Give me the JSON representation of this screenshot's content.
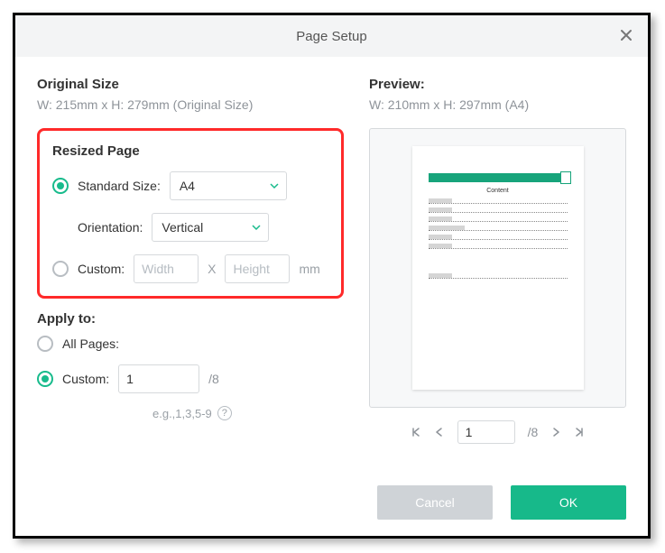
{
  "title": "Page Setup",
  "original": {
    "heading": "Original Size",
    "text": "W: 215mm x H: 279mm (Original Size)"
  },
  "resized": {
    "heading": "Resized Page",
    "standard_label": "Standard Size:",
    "size_value": "A4",
    "orientation_label": "Orientation:",
    "orientation_value": "Vertical",
    "custom_label": "Custom:",
    "width_placeholder": "Width",
    "height_placeholder": "Height",
    "x": "X",
    "unit": "mm",
    "selected": "standard"
  },
  "apply": {
    "heading": "Apply to:",
    "all_label": "All Pages:",
    "custom_label": "Custom:",
    "custom_value": "1",
    "total_suffix": "/8",
    "example": "e.g.,1,3,5-9",
    "selected": "custom"
  },
  "preview": {
    "heading": "Preview:",
    "text": "W: 210mm x H: 297mm (A4)",
    "page_value": "1",
    "total_suffix": "/8",
    "doc_center": "Content"
  },
  "buttons": {
    "cancel": "Cancel",
    "ok": "OK"
  }
}
